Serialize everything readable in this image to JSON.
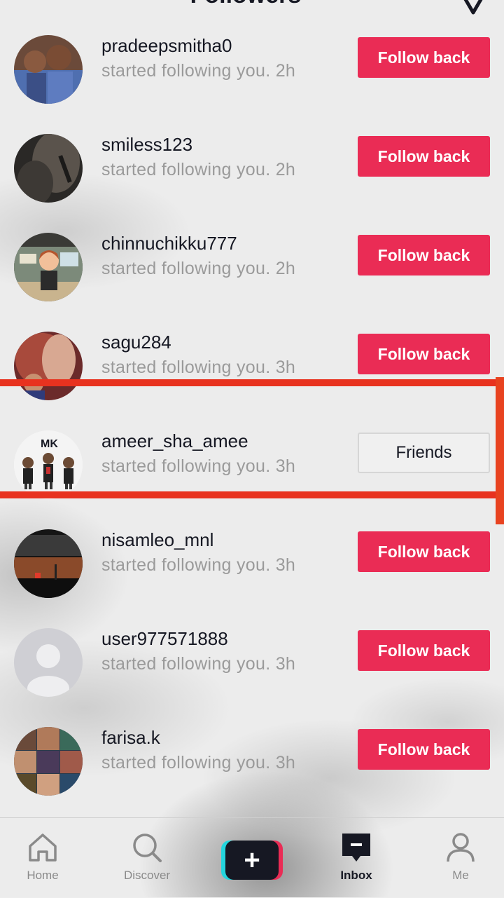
{
  "header": {
    "title": "Followers",
    "caret": "▾"
  },
  "items": [
    {
      "name": "pradeepsmitha0",
      "subtitle": "started following you. 2h",
      "action": "Follow back",
      "type": "follow"
    },
    {
      "name": "smiless123",
      "subtitle": "started following you. 2h",
      "action": "Follow back",
      "type": "follow"
    },
    {
      "name": "chinnuchikku777",
      "subtitle": "started following you. 2h",
      "action": "Follow back",
      "type": "follow"
    },
    {
      "name": "sagu284",
      "subtitle": "started following you. 3h",
      "action": "Follow back",
      "type": "follow"
    },
    {
      "name": "ameer_sha_amee",
      "subtitle": "started following you. 3h",
      "action": "Friends",
      "type": "friends",
      "avatar_text": "MK"
    },
    {
      "name": "nisamleo_mnl",
      "subtitle": "started following you. 3h",
      "action": "Follow back",
      "type": "follow"
    },
    {
      "name": "user977571888",
      "subtitle": "started following you. 3h",
      "action": "Follow back",
      "type": "follow"
    },
    {
      "name": "farisa.k",
      "subtitle": "started following you. 3h",
      "action": "Follow back",
      "type": "follow"
    }
  ],
  "nav": [
    {
      "label": "Home",
      "icon": "home-icon"
    },
    {
      "label": "Discover",
      "icon": "search-icon"
    },
    {
      "label": "",
      "icon": "plus-icon"
    },
    {
      "label": "Inbox",
      "icon": "inbox-icon",
      "active": true
    },
    {
      "label": "Me",
      "icon": "profile-icon"
    }
  ],
  "colors": {
    "accent": "#ea2c55",
    "highlight": "#e8321f",
    "cyan": "#23d5dd",
    "text": "#161823"
  }
}
